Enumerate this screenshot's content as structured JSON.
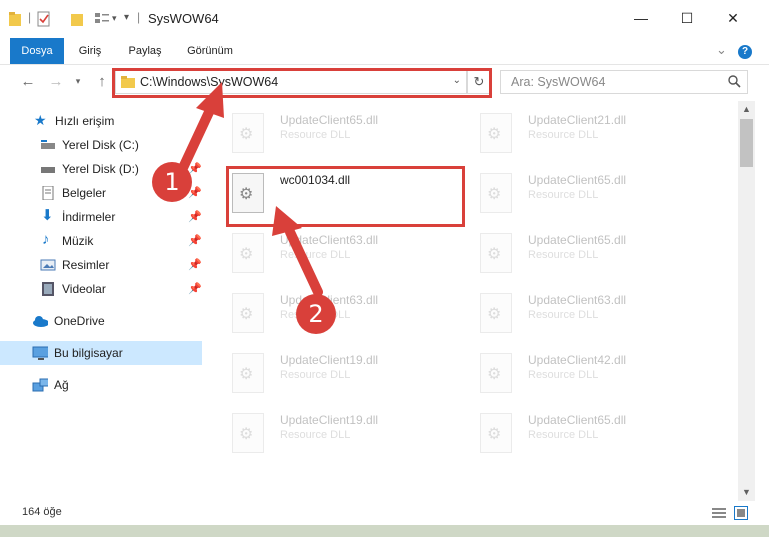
{
  "window": {
    "title": "SysWOW64",
    "buttons": {
      "minimize": "—",
      "maximize": "☐",
      "close": "✕"
    }
  },
  "ribbon": {
    "tabs": [
      {
        "label": "Dosya",
        "active": true
      },
      {
        "label": "Giriş"
      },
      {
        "label": "Paylaş"
      },
      {
        "label": "Görünüm"
      }
    ],
    "expand": "⌄",
    "help": "?"
  },
  "address": {
    "path": "C:\\Windows\\SysWOW64",
    "search_placeholder": "Ara: SysWOW64"
  },
  "sidebar": {
    "quick_access": "Hızlı erişim",
    "items": [
      {
        "label": "Yerel Disk (C:)",
        "icon": "drive-icon",
        "pinned": false
      },
      {
        "label": "Yerel Disk (D:)",
        "icon": "drive-icon",
        "pinned": true
      },
      {
        "label": "Belgeler",
        "icon": "documents-icon",
        "pinned": true
      },
      {
        "label": "İndirmeler",
        "icon": "downloads-icon",
        "pinned": true
      },
      {
        "label": "Müzik",
        "icon": "music-icon",
        "pinned": true
      },
      {
        "label": "Resimler",
        "icon": "pictures-icon",
        "pinned": true
      },
      {
        "label": "Videolar",
        "icon": "videos-icon",
        "pinned": true
      }
    ],
    "onedrive": "OneDrive",
    "this_pc": "Bu bilgisayar",
    "network": "Ağ"
  },
  "files": {
    "col1": [
      {
        "name": "UpdateClient65.dll",
        "type": "Resource DLL"
      },
      {
        "name": "wc001034.dll",
        "type": ""
      },
      {
        "name": "UpdateClient63.dll",
        "type": "Resource DLL"
      },
      {
        "name": "UpdateClient63.dll",
        "type": "Resource DLL"
      },
      {
        "name": "UpdateClient19.dll",
        "type": "Resource DLL"
      },
      {
        "name": "UpdateClient19.dll",
        "type": "Resource DLL"
      }
    ],
    "col2": [
      {
        "name": "UpdateClient21.dll",
        "type": "Resource DLL"
      },
      {
        "name": "UpdateClient65.dll",
        "type": "Resource DLL"
      },
      {
        "name": "UpdateClient65.dll",
        "type": "Resource DLL"
      },
      {
        "name": "UpdateClient63.dll",
        "type": "Resource DLL"
      },
      {
        "name": "UpdateClient42.dll",
        "type": "Resource DLL"
      },
      {
        "name": "UpdateClient65.dll",
        "type": "Resource DLL"
      }
    ]
  },
  "status": {
    "count": "164 öğe"
  },
  "annotations": {
    "step1": "1",
    "step2": "2",
    "color": "#d9403a"
  }
}
